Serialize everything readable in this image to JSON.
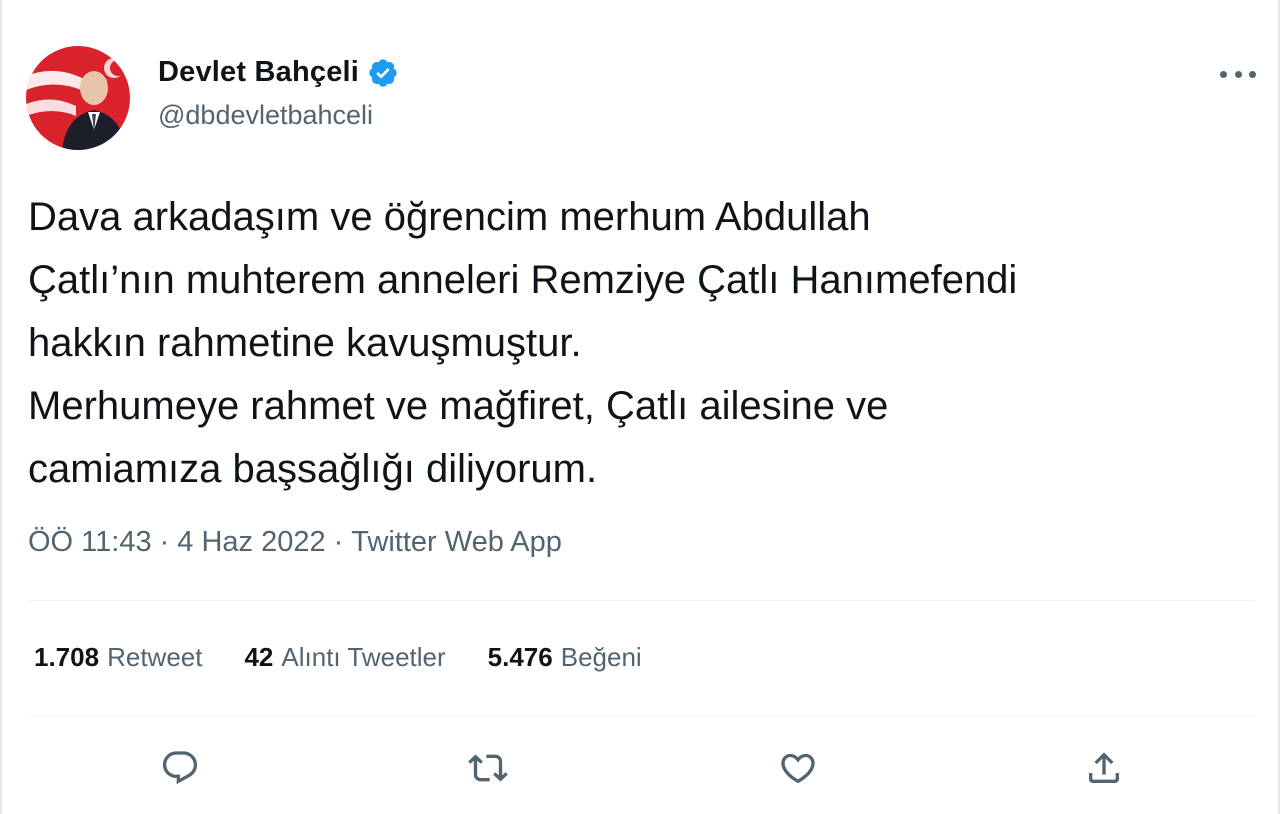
{
  "author": {
    "display_name": "Devlet Bahçeli",
    "handle": "@dbdevletbahceli",
    "verified": true
  },
  "tweet": {
    "lines": [
      "Dava arkadaşım ve öğrencim merhum Abdullah",
      "Çatlı’nın muhterem anneleri Remziye Çatlı Hanımefendi",
      "hakkın rahmetine kavuşmuştur.",
      "Merhumeye rahmet ve mağfiret, Çatlı ailesine ve",
      "camiamıza başsağlığı diliyorum."
    ]
  },
  "meta": {
    "time": "ÖÖ 11:43",
    "separator": "·",
    "date": "4 Haz 2022",
    "source": "Twitter Web App"
  },
  "stats": {
    "retweets": {
      "count": "1.708",
      "label": "Retweet"
    },
    "quotes": {
      "count": "42",
      "label": "Alıntı Tweetler"
    },
    "likes": {
      "count": "5.476",
      "label": "Beğeni"
    }
  },
  "icons": {
    "more": "more-icon",
    "verified": "verified-badge-icon",
    "reply": "reply-icon",
    "retweet": "retweet-icon",
    "like": "like-icon",
    "share": "share-icon"
  },
  "colors": {
    "verified_blue": "#1d9bf0",
    "text_primary": "#0f1419",
    "text_secondary": "#536471",
    "avatar_red": "#d9222a"
  }
}
